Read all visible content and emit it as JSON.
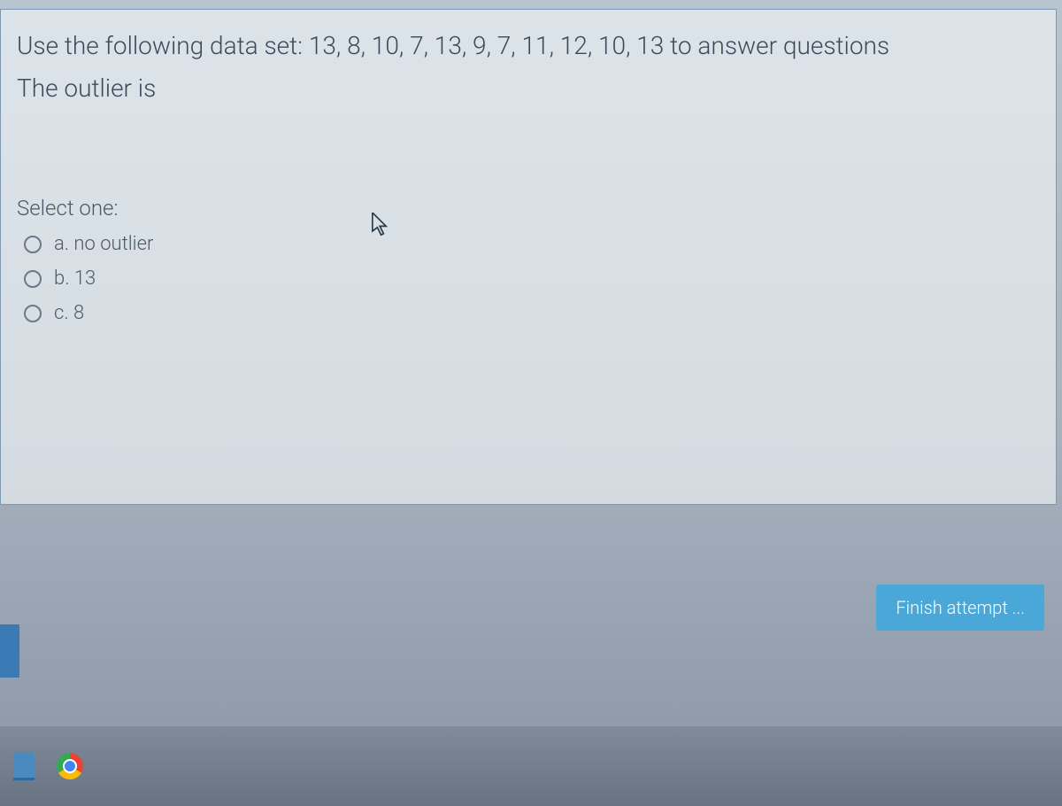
{
  "question": {
    "text_line1": "Use the following data set: 13, 8, 10, 7, 13, 9, 7, 11, 12, 10, 13 to answer questions",
    "text_line2": "The outlier is",
    "select_label": "Select one:",
    "options": [
      {
        "label": "a. no outlier"
      },
      {
        "label": "b. 13"
      },
      {
        "label": "c. 8"
      }
    ]
  },
  "buttons": {
    "finish": "Finish attempt ..."
  },
  "icons": {
    "cursor": "cursor-arrow",
    "file_explorer": "file-explorer-icon",
    "chrome": "chrome-icon"
  },
  "colors": {
    "card_border": "#7a9ab5",
    "text_primary": "#3a4a5a",
    "button_bg": "#4aa8d8",
    "button_text": "#ffffff"
  }
}
